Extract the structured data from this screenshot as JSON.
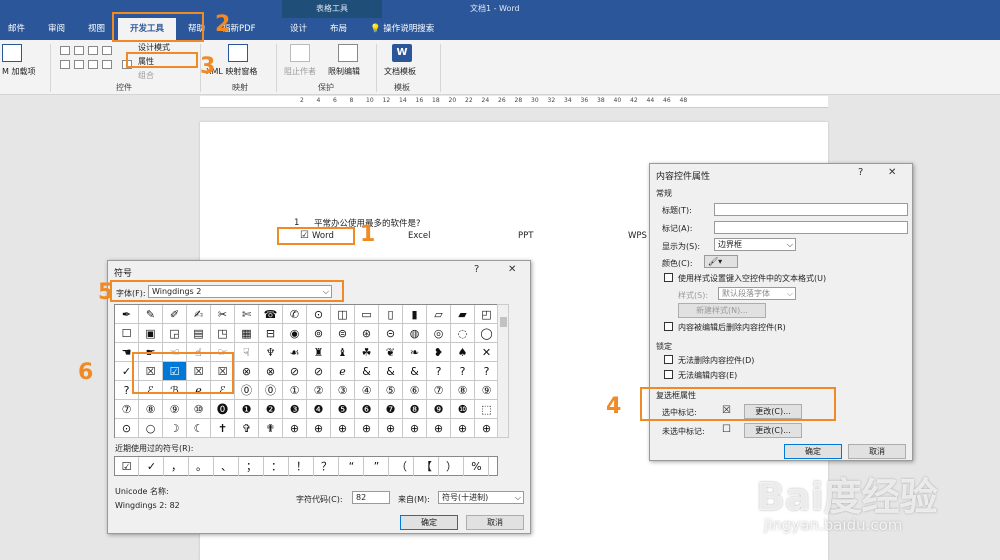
{
  "titlebar": {
    "context_tab": "表格工具",
    "document_title": "文档1  -  Word"
  },
  "tabs": {
    "mail": "邮件",
    "review": "审阅",
    "view": "视图",
    "developer": "开发工具",
    "help": "帮助",
    "pdf": "福新PDF",
    "design": "设计",
    "layout": "布局",
    "tell_me": "操作说明搜索"
  },
  "ribbon": {
    "addins": "M 加载项",
    "design_mode": "设计模式",
    "properties": "属性",
    "group": "组合",
    "xml_mapping": "XML 映射窗格",
    "block_authors": "阻止作者",
    "restrict_editing": "限制编辑",
    "document_template": "文档模板",
    "group_controls": "控件",
    "group_mapping": "映射",
    "group_protect": "保护",
    "group_templates": "模板"
  },
  "ruler_marks": [
    "2",
    "4",
    "6",
    "8",
    "10",
    "12",
    "14",
    "16",
    "18",
    "20",
    "22",
    "24",
    "26",
    "28",
    "30",
    "32",
    "34",
    "36",
    "38",
    "40",
    "42",
    "44",
    "46",
    "48"
  ],
  "document": {
    "question_num": "1",
    "question": "平常办公使用最多的软件是?",
    "options": [
      "Word",
      "Excel",
      "PPT",
      "WPS"
    ]
  },
  "symbol_dialog": {
    "title": "符号",
    "help": "?",
    "close": "✕",
    "font_label": "字体(F):",
    "font_value": "Wingdings 2",
    "grid": [
      [
        "✒",
        "✎",
        "✐",
        "✍",
        "✂",
        "✄",
        "☎",
        "✆",
        "⊙",
        "◫",
        "▭",
        "▯",
        "▮",
        "▱",
        "▰",
        "◰"
      ],
      [
        "☐",
        "▣",
        "◲",
        "▤",
        "◳",
        "▦",
        "⊟",
        "◉",
        "⊚",
        "⊜",
        "⊛",
        "⊝",
        "◍",
        "◎",
        "◌",
        "◯"
      ],
      [
        "☚",
        "☛",
        "☜",
        "☝",
        "☞",
        "☟",
        "♆",
        "☙",
        "♜",
        "♝",
        "☘",
        "❦",
        "❧",
        "❥",
        "♠",
        "✕"
      ],
      [
        "✓",
        "☒",
        "☑",
        "☒",
        "☒",
        "⊗",
        "⊗",
        "⊘",
        "⊘",
        "ℯ",
        "&",
        "&",
        "&",
        "?",
        "?",
        "?"
      ],
      [
        "?",
        "ℰ",
        "ℬ",
        "ℯ",
        "ℰ",
        "⓪",
        "⓪",
        "①",
        "②",
        "③",
        "④",
        "⑤",
        "⑥",
        "⑦",
        "⑧",
        "⑨"
      ],
      [
        "⑦",
        "⑧",
        "⑨",
        "⑩",
        "⓿",
        "❶",
        "❷",
        "❸",
        "❹",
        "❺",
        "❻",
        "❼",
        "❽",
        "❾",
        "❿",
        "⬚"
      ],
      [
        "⊙",
        "○",
        "☽",
        "☾",
        "✝",
        "✞",
        "✟",
        "⊕",
        "⊕",
        "⊕",
        "⊕",
        "⊕",
        "⊕",
        "⊕",
        "⊕",
        "⊕"
      ]
    ],
    "recent_label": "近期使用过的符号(R):",
    "recent": [
      "☑",
      "✓",
      "，",
      "。",
      "、",
      "；",
      "：",
      "！",
      "？",
      "“",
      "”",
      "（",
      "【",
      "）",
      "%"
    ],
    "unicode_name_label": "Unicode 名称:",
    "char_name": "Wingdings 2: 82",
    "char_code_label": "字符代码(C):",
    "char_code": "82",
    "from_label": "来自(M):",
    "from_value": "符号(十进制)",
    "ok": "确定",
    "cancel": "取消"
  },
  "props_dialog": {
    "title": "内容控件属性",
    "help": "?",
    "close": "✕",
    "general": "常规",
    "title_label": "标题(T):",
    "tag_label": "标记(A):",
    "show_as_label": "显示为(S):",
    "show_as_value": "边界框",
    "color_label": "颜色(C):",
    "use_style": "使用样式设置键入空控件中的文本格式(U)",
    "style_label": "样式(S):",
    "style_value": "默认段落字体",
    "new_style": "新建样式(N)...",
    "remove_on_edit": "内容被编辑后删除内容控件(R)",
    "locking": "锁定",
    "no_delete": "无法删除内容控件(D)",
    "no_edit": "无法编辑内容(E)",
    "checkbox_props": "复选框属性",
    "checked_label": "选中标记:",
    "checked_symbol": "☒",
    "unchecked_label": "未选中标记:",
    "unchecked_symbol": "☐",
    "change": "更改(C)...",
    "ok": "确定",
    "cancel": "取消"
  },
  "annotations": [
    "1",
    "2",
    "3",
    "4",
    "5",
    "6"
  ],
  "watermark": {
    "big": "Bai度经验",
    "small": "jingyan.baidu.com"
  },
  "colors": {
    "accent": "#2b579a",
    "annotation": "#f08a24",
    "selection": "#0078d7"
  }
}
